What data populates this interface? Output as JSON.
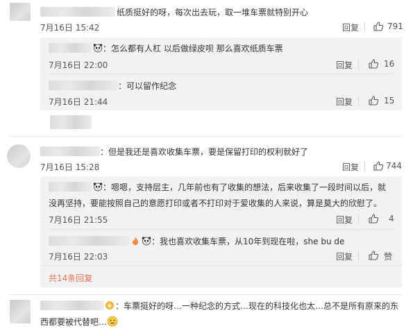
{
  "comments": [
    {
      "text": "纸质挺好的呀，每次出去玩，取一堆车票就特别开心",
      "time": "7月16日 15:42",
      "reply_label": "回复",
      "likes": "791",
      "replies": [
        {
          "text": "：怎么都有人杠 以后做绿皮呗 那么喜欢纸质车票",
          "time": "7月16日 22:00",
          "reply_label": "回复",
          "likes": "16"
        },
        {
          "text": "：可以留作纪念",
          "time": "7月16日 21:44",
          "reply_label": "回复",
          "likes": "15"
        }
      ]
    },
    {
      "text": "：但是我还是喜欢收集车票，要是保留打印的权利就好了",
      "time": "7月16日 15:28",
      "reply_label": "回复",
      "likes": "744",
      "replies": [
        {
          "text_line1": "：嗯嗯，支持层主，几年前也有了收集的想法，后来收集了一段时间以后，就",
          "text_line2": "没再坚持，要能按照自己的意愿打印或者不打印对于爱收集的人来说，算是莫大的欣慰了。",
          "time": "7月16日 21:55",
          "reply_label": "回复",
          "likes": "4"
        },
        {
          "text": "：我也喜欢收集车票，从10年到现在啦，she bu de",
          "time": "7月16日 22:03",
          "reply_label": "回复",
          "likes": "赞"
        }
      ],
      "more_replies": "共14条回复"
    },
    {
      "text_line1": "：车票挺好的呀…一种纪念的方式…现在的科技化也太…总不是所有原来的东",
      "text_line2": "西都要被代替吧…"
    }
  ],
  "icons": {
    "like": "thumb-up-icon",
    "panda": "panda-emoji-icon",
    "fire": "fire-badge-icon",
    "medal": "medal-badge-icon",
    "thinking": "thinking-emoji-icon"
  },
  "colors": {
    "link": "#eb7350",
    "subbox": "#f2f2f5",
    "text": "#333333",
    "meta": "#555555"
  }
}
